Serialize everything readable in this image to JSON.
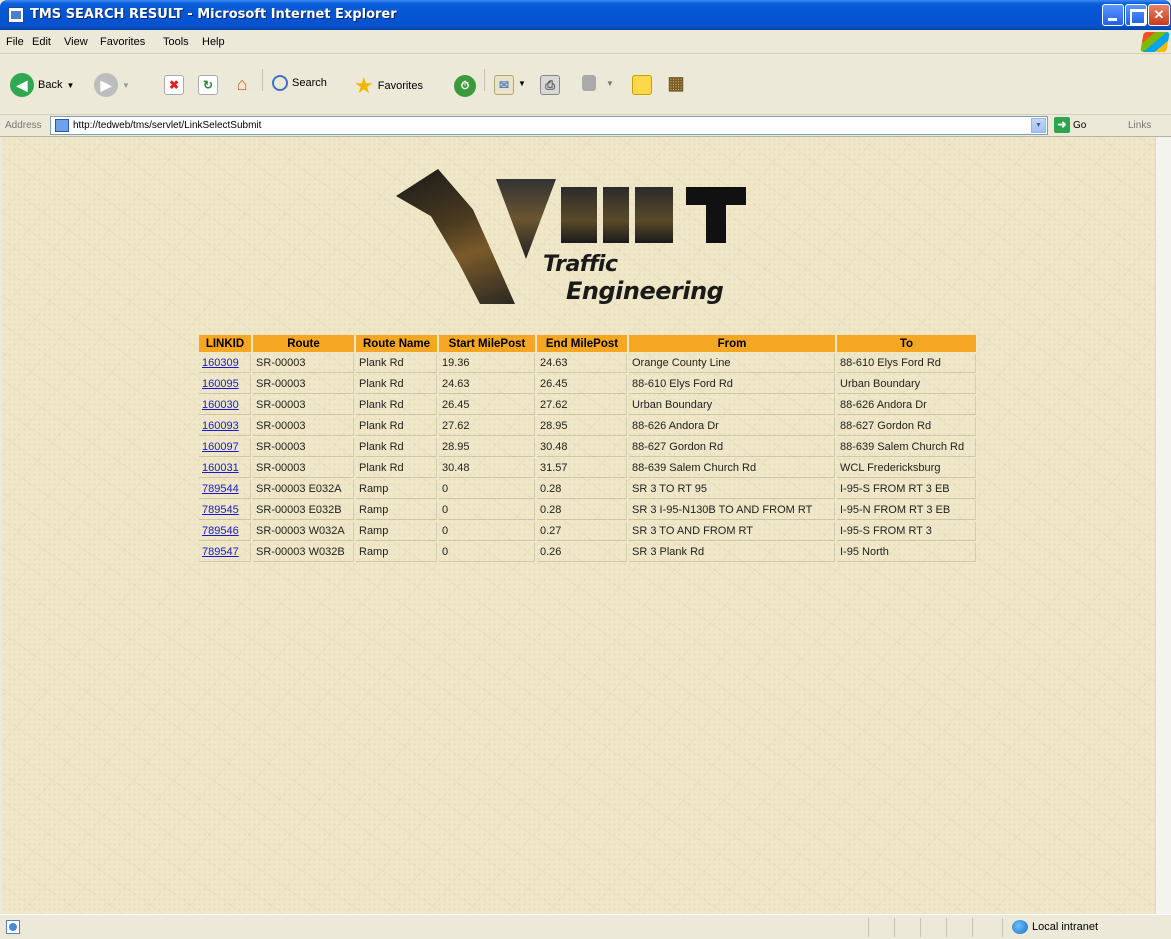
{
  "window": {
    "title": "TMS SEARCH RESULT - Microsoft Internet Explorer"
  },
  "menu": [
    "File",
    "Edit",
    "View",
    "Favorites",
    "Tools",
    "Help"
  ],
  "toolbar": {
    "back_label": "Back",
    "search_label": "Search",
    "favorites_label": "Favorites"
  },
  "address": {
    "label": "Address",
    "url": "http://tedweb/tms/servlet/LinkSelectSubmit",
    "go_label": "Go",
    "links_label": "Links"
  },
  "logo": {
    "line1": "Traffic",
    "line2": "Engineering"
  },
  "table": {
    "headers": [
      "LINKID",
      "Route",
      "Route Name",
      "Start MilePost",
      "End MilePost",
      "From",
      "To"
    ],
    "rows": [
      [
        "160309",
        "SR-00003",
        "Plank Rd",
        "19.36",
        "24.63",
        "Orange County Line",
        "88-610 Elys Ford Rd"
      ],
      [
        "160095",
        "SR-00003",
        "Plank Rd",
        "24.63",
        "26.45",
        "88-610 Elys Ford Rd",
        "Urban Boundary"
      ],
      [
        "160030",
        "SR-00003",
        "Plank Rd",
        "26.45",
        "27.62",
        "Urban Boundary",
        "88-626 Andora Dr"
      ],
      [
        "160093",
        "SR-00003",
        "Plank Rd",
        "27.62",
        "28.95",
        "88-626 Andora Dr",
        "88-627 Gordon Rd"
      ],
      [
        "160097",
        "SR-00003",
        "Plank Rd",
        "28.95",
        "30.48",
        "88-627 Gordon Rd",
        "88-639 Salem Church Rd"
      ],
      [
        "160031",
        "SR-00003",
        "Plank Rd",
        "30.48",
        "31.57",
        "88-639 Salem Church Rd",
        "WCL Fredericksburg"
      ],
      [
        "789544",
        "SR-00003 E032A",
        "Ramp",
        "0",
        "0.28",
        "SR 3 TO RT 95",
        "I-95-S FROM RT 3 EB"
      ],
      [
        "789545",
        "SR-00003 E032B",
        "Ramp",
        "0",
        "0.28",
        "SR 3 I-95-N130B TO AND FROM RT",
        "I-95-N FROM RT 3 EB"
      ],
      [
        "789546",
        "SR-00003 W032A",
        "Ramp",
        "0",
        "0.27",
        "SR 3 TO AND FROM RT",
        "I-95-S FROM RT 3"
      ],
      [
        "789547",
        "SR-00003 W032B",
        "Ramp",
        "0",
        "0.26",
        "SR 3 Plank Rd",
        "I-95 North"
      ]
    ]
  },
  "status": {
    "zone": "Local intranet"
  },
  "colors": {
    "header_bg": "#f5a623",
    "link": "#1a1acc",
    "page_bg": "#efe7c7",
    "titlebar": "#0554d2"
  }
}
